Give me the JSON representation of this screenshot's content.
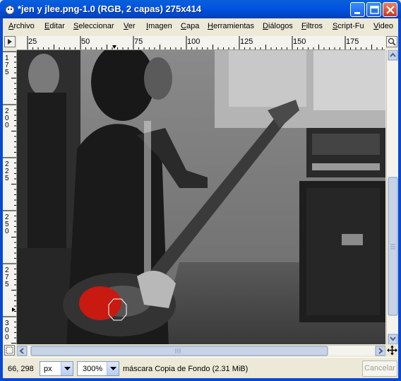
{
  "window": {
    "title": "*jen y jlee.png-1.0 (RGB, 2 capas) 275x414",
    "controls": {
      "minimize": "minimize-icon",
      "maximize": "maximize-icon",
      "close": "close-icon"
    }
  },
  "menu": [
    {
      "label": "Archivo",
      "key": "A"
    },
    {
      "label": "Editar",
      "key": "E"
    },
    {
      "label": "Seleccionar",
      "key": "S"
    },
    {
      "label": "Ver",
      "key": "V"
    },
    {
      "label": "Imagen",
      "key": "I"
    },
    {
      "label": "Capa",
      "key": "C"
    },
    {
      "label": "Herramientas",
      "key": "H"
    },
    {
      "label": "Diálogos",
      "key": "D"
    },
    {
      "label": "Filtros",
      "key": "F"
    },
    {
      "label": "Script-Fu",
      "key": "S"
    },
    {
      "label": "Video",
      "key": "V"
    }
  ],
  "ruler": {
    "horizontal_labels": [
      "25",
      "50",
      "75",
      "100",
      "125",
      "150",
      "175"
    ],
    "vertical_labels": [
      "175",
      "200",
      "225",
      "250",
      "275",
      "300"
    ]
  },
  "status": {
    "coordinates": "66, 298",
    "unit": "px",
    "zoom": "300%",
    "message": "máscara Copia de Fondo (2.31 MiB)",
    "cancel_label": "Cancelar"
  },
  "colors": {
    "titlebar": "#0054e3",
    "mask_overlay": "#c81a10"
  }
}
